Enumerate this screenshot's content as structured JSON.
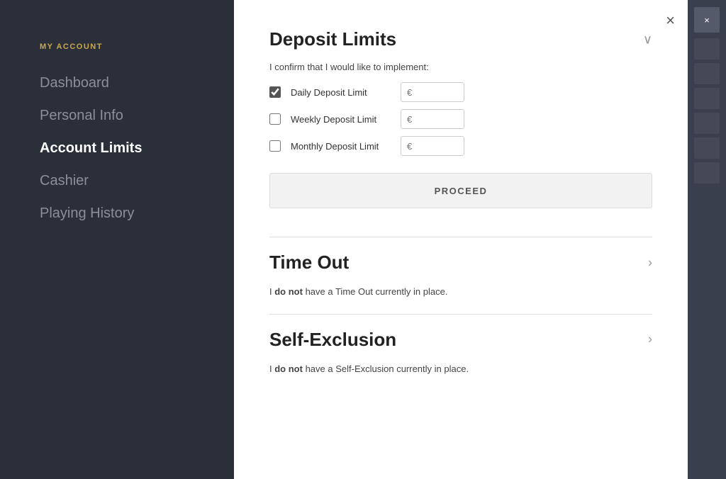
{
  "sidebar": {
    "section_label": "MY ACCOUNT",
    "items": [
      {
        "id": "dashboard",
        "label": "Dashboard",
        "active": false
      },
      {
        "id": "personal-info",
        "label": "Personal Info",
        "active": false
      },
      {
        "id": "account-limits",
        "label": "Account Limits",
        "active": true
      },
      {
        "id": "cashier",
        "label": "Cashier",
        "active": false
      },
      {
        "id": "playing-history",
        "label": "Playing History",
        "active": false
      }
    ]
  },
  "panel": {
    "close_label": "×",
    "sections": {
      "deposit_limits": {
        "title": "Deposit Limits",
        "confirm_text": "I confirm that I would like to implement:",
        "limits": [
          {
            "id": "daily",
            "label": "Daily Deposit Limit",
            "checked": true,
            "placeholder": "€"
          },
          {
            "id": "weekly",
            "label": "Weekly Deposit Limit",
            "checked": false,
            "placeholder": "€"
          },
          {
            "id": "monthly",
            "label": "Monthly Deposit Limit",
            "checked": false,
            "placeholder": "€"
          }
        ],
        "proceed_label": "PROCEED",
        "chevron": "∨"
      },
      "time_out": {
        "title": "Time Out",
        "text_prefix": "I ",
        "text_bold": "do not",
        "text_suffix": " have a Time Out currently in place.",
        "chevron": "›"
      },
      "self_exclusion": {
        "title": "Self-Exclusion",
        "text_prefix": "I ",
        "text_bold": "do not",
        "text_suffix": " have a Self-Exclusion currently in place.",
        "chevron": "›"
      }
    }
  },
  "right_strip": {
    "close_label": "×"
  }
}
